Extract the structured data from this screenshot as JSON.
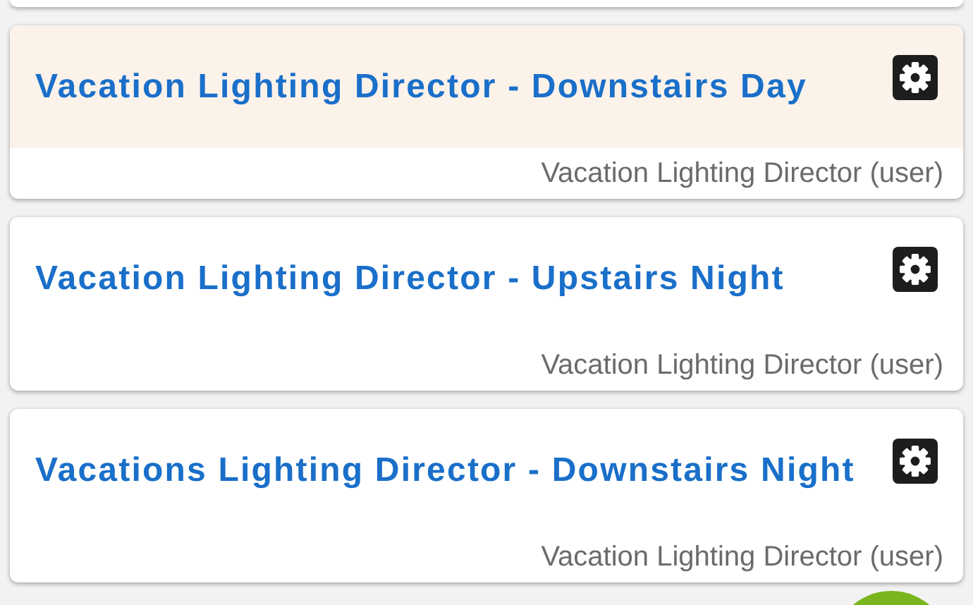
{
  "cards": [
    {
      "title": "Vacation Lighting Director - Downstairs Day",
      "subtitle": "Vacation Lighting Director (user)",
      "selected": true
    },
    {
      "title": "Vacation Lighting Director - Upstairs Night",
      "subtitle": "Vacation Lighting Director (user)",
      "selected": false
    },
    {
      "title": "Vacations Lighting Director - Downstairs Night",
      "subtitle": "Vacation Lighting Director (user)",
      "selected": false
    }
  ]
}
